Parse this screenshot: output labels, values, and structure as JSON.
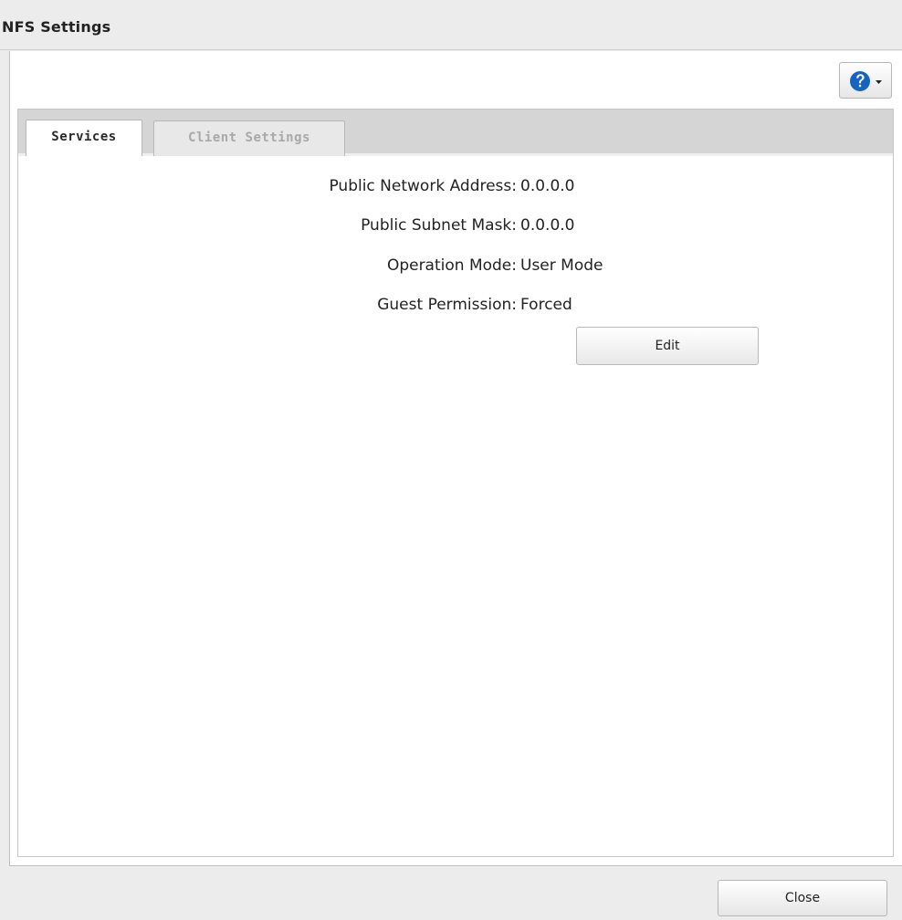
{
  "window": {
    "title": "NFS Settings"
  },
  "toolbar": {
    "help_icon": "help-question-icon",
    "help_menu_icon": "chevron-down-icon"
  },
  "tabs": [
    {
      "label": "Services",
      "selected": true
    },
    {
      "label": "Client Settings",
      "selected": false
    }
  ],
  "services": {
    "rows": [
      {
        "label": "Public Network Address:",
        "value": "0.0.0.0"
      },
      {
        "label": "Public Subnet Mask:",
        "value": "0.0.0.0"
      },
      {
        "label": "Operation Mode:",
        "value": "User Mode"
      },
      {
        "label": "Guest Permission:",
        "value": "Forced"
      }
    ],
    "edit_label": "Edit"
  },
  "footer": {
    "close_label": "Close"
  },
  "colors": {
    "help_icon": "#1565c0",
    "background": "#ececec",
    "tabbar": "#d5d5d5"
  }
}
